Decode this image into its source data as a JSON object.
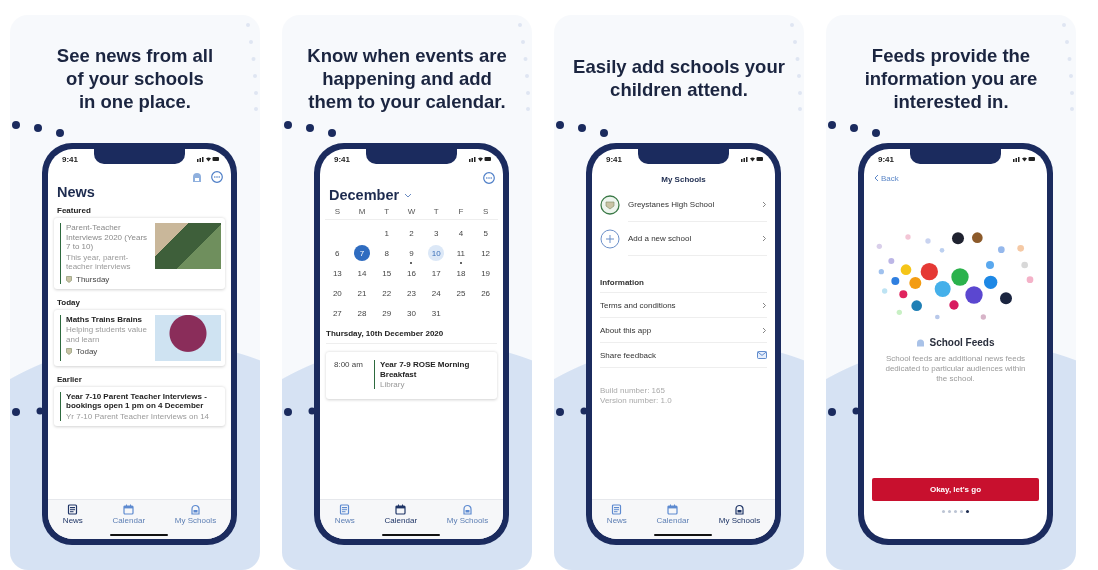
{
  "panels": [
    {
      "caption": "See news from all\nof your schools\nin one place.",
      "screen": {
        "kind": "news",
        "time": "9:41",
        "title": "News",
        "sections": [
          {
            "heading": "Featured",
            "cards": [
              {
                "kind": "photo",
                "title": "Parent-Teacher Interviews 2020 (Years 7 to 10)",
                "snippet": "This year, parent-teacher interviews",
                "date": "Thursday",
                "read": true
              }
            ]
          },
          {
            "heading": "Today",
            "cards": [
              {
                "kind": "graphic",
                "title": "Maths Trains Brains",
                "snippet": "Helping students value and learn",
                "date": "Today",
                "read": false
              }
            ]
          },
          {
            "heading": "Earlier",
            "cards": [
              {
                "kind": "text",
                "title": "Year 7-10 Parent Teacher Interviews - bookings open 1 pm on 4 December",
                "snippet": "Yr 7-10 Parent Teacher Interviews on 14",
                "read": false
              }
            ]
          }
        ],
        "tabs": [
          {
            "label": "News",
            "selected": true
          },
          {
            "label": "Calendar",
            "selected": false
          },
          {
            "label": "My Schools",
            "selected": false
          }
        ]
      }
    },
    {
      "caption": "Know when events are\nhappening and add\nthem to your calendar.",
      "screen": {
        "kind": "calendar",
        "time": "9:41",
        "month": "December",
        "weekdays": [
          "S",
          "M",
          "T",
          "W",
          "T",
          "F",
          "S"
        ],
        "weeks": [
          [
            {
              "kind": "empty"
            },
            {
              "kind": "empty"
            },
            {
              "kind": "day",
              "label": "1",
              "selected": false,
              "highlighted": false,
              "has_event": false
            },
            {
              "kind": "day",
              "label": "2",
              "selected": false,
              "highlighted": false,
              "has_event": false
            },
            {
              "kind": "day",
              "label": "3",
              "selected": false,
              "highlighted": false,
              "has_event": false
            },
            {
              "kind": "day",
              "label": "4",
              "selected": false,
              "highlighted": false,
              "has_event": false
            },
            {
              "kind": "day",
              "label": "5",
              "selected": false,
              "highlighted": false,
              "has_event": false
            }
          ],
          [
            {
              "kind": "day",
              "label": "6",
              "selected": false,
              "highlighted": false,
              "has_event": false
            },
            {
              "kind": "day",
              "label": "7",
              "selected": true,
              "highlighted": false,
              "has_event": false
            },
            {
              "kind": "day",
              "label": "8",
              "selected": false,
              "highlighted": false,
              "has_event": false
            },
            {
              "kind": "day",
              "label": "9",
              "selected": false,
              "highlighted": false,
              "has_event": true
            },
            {
              "kind": "day",
              "label": "10",
              "selected": false,
              "highlighted": true,
              "has_event": false
            },
            {
              "kind": "day",
              "label": "11",
              "selected": false,
              "highlighted": false,
              "has_event": true
            },
            {
              "kind": "day",
              "label": "12",
              "selected": false,
              "highlighted": false,
              "has_event": false
            }
          ],
          [
            {
              "kind": "day",
              "label": "13",
              "selected": false,
              "highlighted": false,
              "has_event": false
            },
            {
              "kind": "day",
              "label": "14",
              "selected": false,
              "highlighted": false,
              "has_event": false
            },
            {
              "kind": "day",
              "label": "15",
              "selected": false,
              "highlighted": false,
              "has_event": false
            },
            {
              "kind": "day",
              "label": "16",
              "selected": false,
              "highlighted": false,
              "has_event": false
            },
            {
              "kind": "day",
              "label": "17",
              "selected": false,
              "highlighted": false,
              "has_event": false
            },
            {
              "kind": "day",
              "label": "18",
              "selected": false,
              "highlighted": false,
              "has_event": false
            },
            {
              "kind": "day",
              "label": "19",
              "selected": false,
              "highlighted": false,
              "has_event": false
            }
          ],
          [
            {
              "kind": "day",
              "label": "20",
              "selected": false,
              "highlighted": false,
              "has_event": false
            },
            {
              "kind": "day",
              "label": "21",
              "selected": false,
              "highlighted": false,
              "has_event": false
            },
            {
              "kind": "day",
              "label": "22",
              "selected": false,
              "highlighted": false,
              "has_event": false
            },
            {
              "kind": "day",
              "label": "23",
              "selected": false,
              "highlighted": false,
              "has_event": false
            },
            {
              "kind": "day",
              "label": "24",
              "selected": false,
              "highlighted": false,
              "has_event": false
            },
            {
              "kind": "day",
              "label": "25",
              "selected": false,
              "highlighted": false,
              "has_event": false
            },
            {
              "kind": "day",
              "label": "26",
              "selected": false,
              "highlighted": false,
              "has_event": false
            }
          ],
          [
            {
              "kind": "day",
              "label": "27",
              "selected": false,
              "highlighted": false,
              "has_event": false
            },
            {
              "kind": "day",
              "label": "28",
              "selected": false,
              "highlighted": false,
              "has_event": false
            },
            {
              "kind": "day",
              "label": "29",
              "selected": false,
              "highlighted": false,
              "has_event": false
            },
            {
              "kind": "day",
              "label": "30",
              "selected": false,
              "highlighted": false,
              "has_event": false
            },
            {
              "kind": "day",
              "label": "31",
              "selected": false,
              "highlighted": false,
              "has_event": false
            },
            {
              "kind": "empty"
            },
            {
              "kind": "empty"
            }
          ]
        ],
        "date_heading": "Thursday, 10th December 2020",
        "events": [
          {
            "time": "8:00 am",
            "title": "Year 7-9 ROSE Morning Breakfast",
            "location": "Library"
          }
        ],
        "tabs": [
          {
            "label": "News",
            "selected": false
          },
          {
            "label": "Calendar",
            "selected": true
          },
          {
            "label": "My Schools",
            "selected": false
          }
        ]
      }
    },
    {
      "caption": "Easily add schools your\nchildren attend.",
      "screen": {
        "kind": "schools",
        "time": "9:41",
        "title": "My Schools",
        "schools": [
          {
            "kind": "school",
            "label": "Greystanes High School"
          },
          {
            "kind": "add",
            "label": "Add a new school"
          }
        ],
        "info_heading": "Information",
        "info_items": [
          {
            "kind": "link",
            "label": "Terms and conditions"
          },
          {
            "kind": "link",
            "label": "About this app"
          },
          {
            "kind": "mail",
            "label": "Share feedback"
          }
        ],
        "build": "Build number: 165",
        "version": "Version number: 1.0",
        "tabs": [
          {
            "label": "News",
            "selected": false
          },
          {
            "label": "Calendar",
            "selected": false
          },
          {
            "label": "My Schools",
            "selected": true
          }
        ]
      }
    },
    {
      "caption": "Feeds provide the\ninformation you are\ninterested in.",
      "screen": {
        "kind": "feeds",
        "time": "9:41",
        "back": "Back",
        "title": "School Feeds",
        "description": "School feeds are additional news feeds dedicated to particular audiences within the school.",
        "button": "Okay, let's go",
        "pages": [
          {
            "selected": false
          },
          {
            "selected": false
          },
          {
            "selected": false
          },
          {
            "selected": false
          },
          {
            "selected": true
          }
        ]
      }
    }
  ]
}
